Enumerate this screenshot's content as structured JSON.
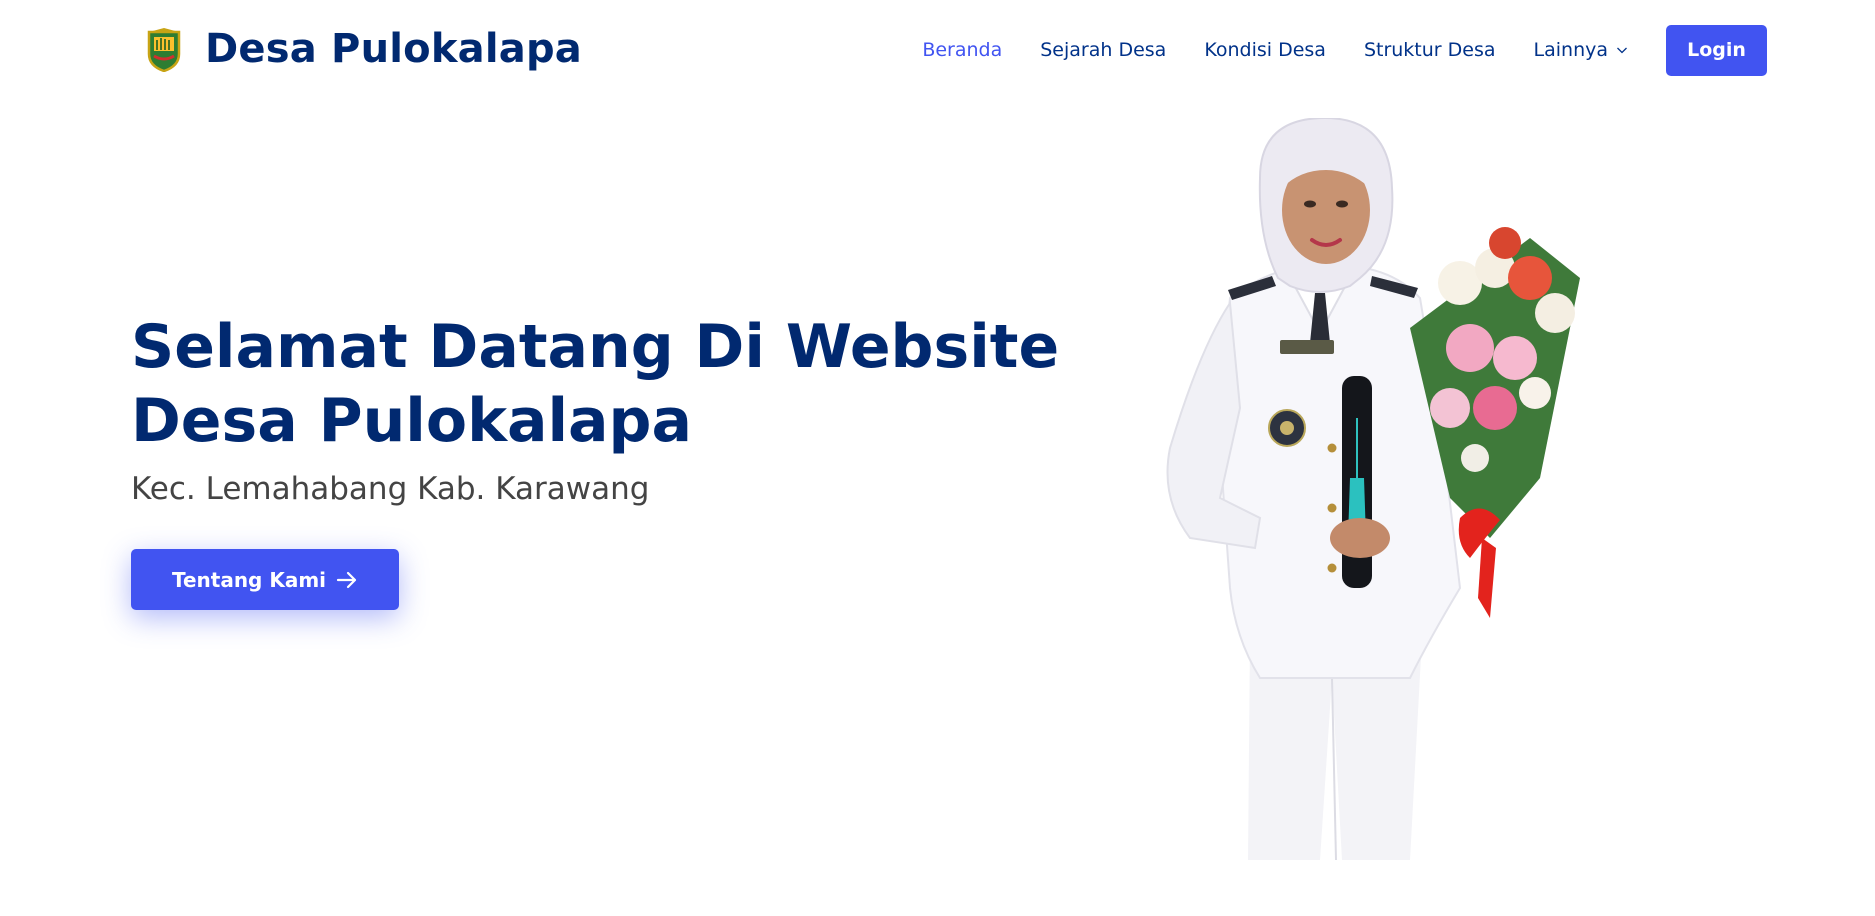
{
  "brand": {
    "name": "Desa Pulokalapa",
    "logo_icon": "regency-crest-icon"
  },
  "nav": {
    "items": [
      {
        "label": "Beranda",
        "active": true
      },
      {
        "label": "Sejarah Desa",
        "active": false
      },
      {
        "label": "Kondisi Desa",
        "active": false
      },
      {
        "label": "Struktur Desa",
        "active": false
      }
    ],
    "dropdown_label": "Lainnya",
    "dropdown_icon": "chevron-down-icon",
    "login_label": "Login"
  },
  "hero": {
    "title_line1": "Selamat Datang Di Website",
    "title_line2": "Desa Pulokalapa",
    "subtitle": "Kec. Lemahabang Kab. Karawang",
    "cta_label": "Tentang Kami",
    "cta_icon": "arrow-right-icon",
    "image_icon": "village-head-photo"
  },
  "colors": {
    "primary": "#4154f1",
    "navy": "#012970",
    "text_gray": "#444444"
  }
}
